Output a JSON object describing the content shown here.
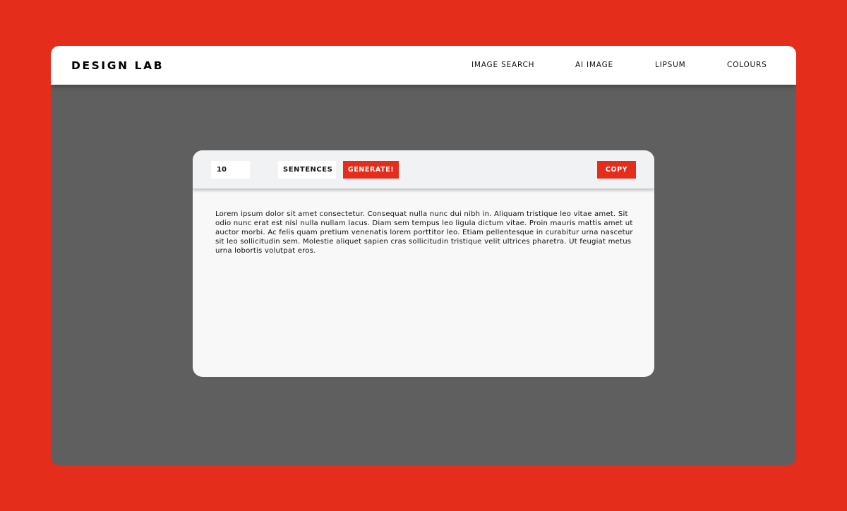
{
  "header": {
    "brand": "DESIGN LAB",
    "nav": [
      "IMAGE SEARCH",
      "AI IMAGE",
      "LIPSUM",
      "COLOURS"
    ]
  },
  "generator": {
    "count_value": "10",
    "unit_label": "SENTENCES",
    "generate_label": "GENERATE!",
    "copy_label": "COPY"
  },
  "output": {
    "text": "Lorem ipsum dolor sit amet consectetur. Consequat nulla nunc dui nibh in. Aliquam tristique leo vitae amet. Sit odio nunc erat est nisl nulla nullam lacus. Diam sem tempus leo ligula dictum vitae. Proin mauris mattis amet ut auctor morbi. Ac felis quam pretium venenatis lorem porttitor leo. Etiam pellentesque in curabitur urna nascetur sit leo sollicitudin sem. Molestie aliquet sapien cras sollicitudin tristique velit ultrices pharetra. Ut feugiat metus urna lobortis volutpat eros."
  },
  "colors": {
    "accent": "#e52d1b",
    "background": "#e52d1b",
    "window_bg": "#5f5f5f",
    "card_bg": "#f8f8f8",
    "toolbar_bg": "#f1f2f4"
  }
}
